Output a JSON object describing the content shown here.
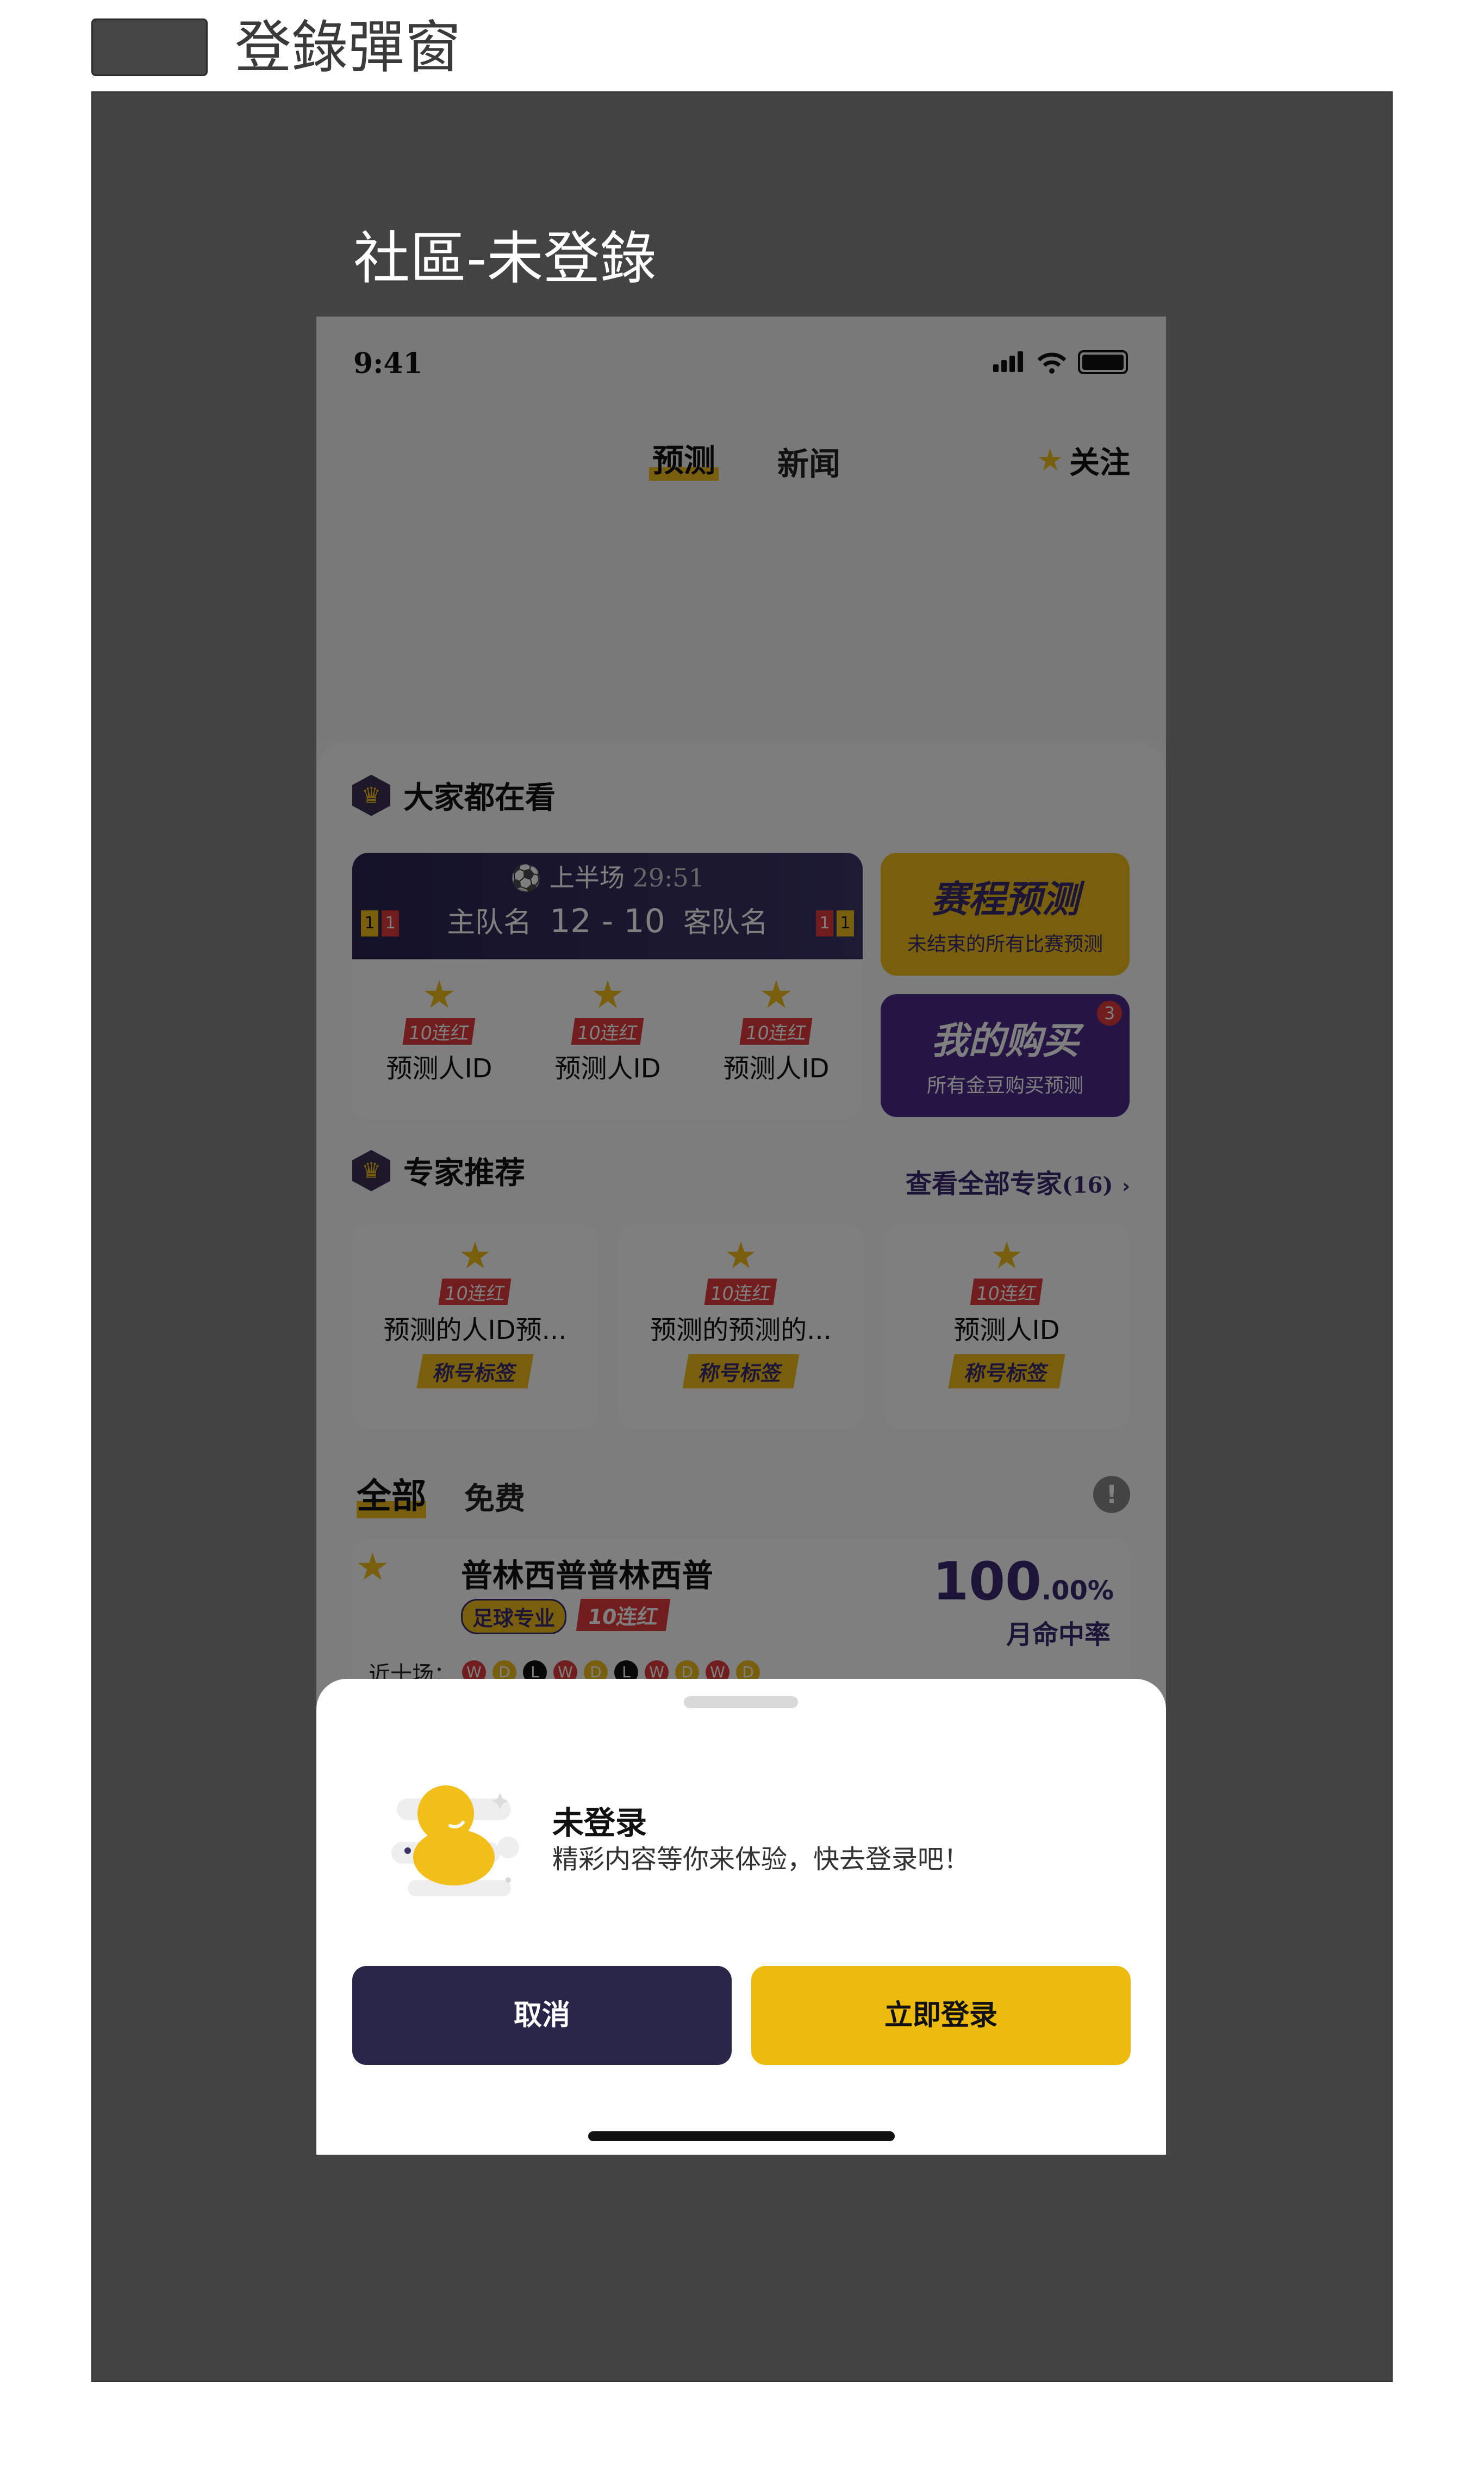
{
  "doc": {
    "title": "登錄彈窗",
    "frame_title": "社區-未登錄"
  },
  "status": {
    "time": "9:41"
  },
  "nav": {
    "tab_predict": "预测",
    "tab_news": "新闻",
    "follow": "关注"
  },
  "watching": {
    "title": "大家都在看",
    "match": {
      "half": "上半场",
      "clock": "29:51",
      "home": "主队名",
      "score": "12 - 10",
      "away": "客队名",
      "home_yellow": "1",
      "home_red": "1",
      "away_red": "1",
      "away_yellow": "1"
    },
    "predictors": [
      {
        "streak": "10连红",
        "name": "预测人ID"
      },
      {
        "streak": "10连红",
        "name": "预测人ID"
      },
      {
        "streak": "10连红",
        "name": "预测人ID"
      }
    ],
    "promo_schedule": {
      "title": "赛程预测",
      "subtitle": "未结束的所有比赛预测"
    },
    "promo_purchase": {
      "title": "我的购买",
      "subtitle": "所有金豆购买预测",
      "badge": "3"
    }
  },
  "experts": {
    "title": "专家推荐",
    "view_all": "查看全部专家",
    "count": "(16)",
    "items": [
      {
        "streak": "10连红",
        "name": "预测的人ID预...",
        "tag": "称号标签"
      },
      {
        "streak": "10连红",
        "name": "预测的预测的...",
        "tag": "称号标签"
      },
      {
        "streak": "10连红",
        "name": "预测人ID",
        "tag": "称号标签"
      }
    ]
  },
  "filter": {
    "all": "全部",
    "free": "免费",
    "info": "!"
  },
  "list": [
    {
      "name": "普林西普普林西普",
      "chip": "足球专业",
      "streak": "10连红",
      "pct_main": "100",
      "pct_dec": ".00%",
      "rate_label": "月命中率",
      "recent_label": "近十场：",
      "recent": [
        "W",
        "D",
        "L",
        "W",
        "D",
        "L",
        "W",
        "D",
        "W",
        "D"
      ]
    }
  ],
  "sheet": {
    "title": "未登录",
    "subtitle": "精彩内容等你来体验，快去登录吧！",
    "cancel": "取消",
    "login": "立即登录"
  }
}
